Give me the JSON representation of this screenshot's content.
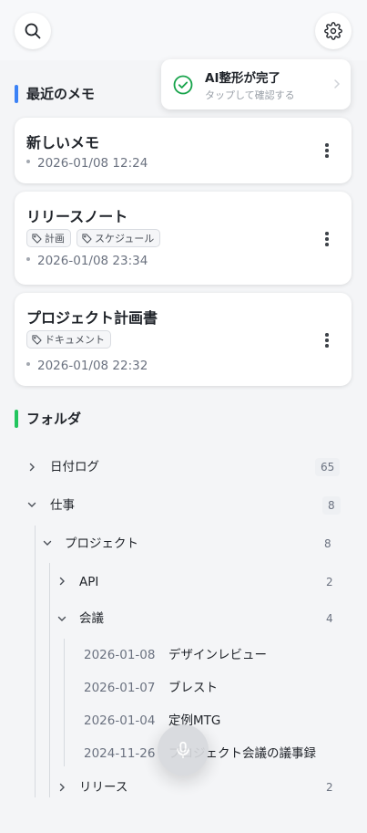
{
  "toast": {
    "title": "AI整形が完了",
    "subtitle": "タップして確認する"
  },
  "recent": {
    "title": "最近のメモ",
    "cards": [
      {
        "title": "新しいメモ",
        "date": "2026-01/08 12:24",
        "tags": []
      },
      {
        "title": "リリースノート",
        "date": "2026-01/08 23:34",
        "tags": [
          "計画",
          "スケジュール"
        ]
      },
      {
        "title": "プロジェクト計画書",
        "date": "2026-01/08 22:32",
        "tags": [
          "ドキュメント"
        ]
      }
    ]
  },
  "folders": {
    "title": "フォルダ",
    "items": [
      {
        "label": "日付ログ",
        "count": "65",
        "expanded": false
      },
      {
        "label": "仕事",
        "count": "8",
        "expanded": true
      },
      {
        "label": "プロジェクト",
        "count": "8",
        "expanded": true
      },
      {
        "label": "API",
        "count": "2",
        "expanded": false
      },
      {
        "label": "会議",
        "count": "4",
        "expanded": true
      },
      {
        "label": "リリース",
        "count": "2",
        "expanded": false
      }
    ],
    "meetings": [
      {
        "date": "2026-01-08",
        "title": "デザインレビュー"
      },
      {
        "date": "2026-01-07",
        "title": "ブレスト"
      },
      {
        "date": "2026-01-04",
        "title": "定例MTG"
      },
      {
        "date": "2024-11-26",
        "title": "プロジェクト会議の議事録"
      }
    ]
  },
  "colors": {
    "recent_accent": "#3b82f6",
    "folder_accent": "#22c55e",
    "success": "#16a34a"
  },
  "icons": {
    "search": "search-icon",
    "settings": "gear-icon",
    "mic": "microphone-icon",
    "tag": "tag-icon",
    "more": "more-vertical-icon"
  }
}
